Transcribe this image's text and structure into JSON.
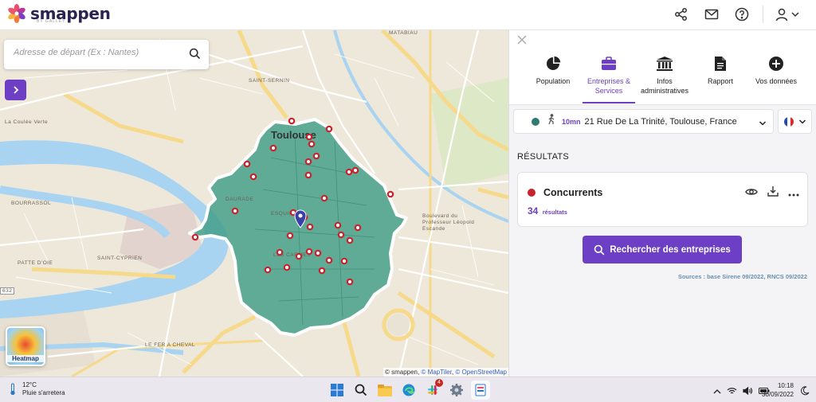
{
  "app": {
    "name": "smappen",
    "logo_sub": "BY GALLEY"
  },
  "header": {
    "icons": [
      "share-icon",
      "mail-icon",
      "help-icon",
      "user-icon",
      "chevron-down-icon"
    ]
  },
  "map": {
    "search_placeholder": "Adresse de départ (Ex : Nantes)",
    "search_value": "",
    "heatmap_label": "Heatmap",
    "attribution_prefix": "© smappen, ",
    "attribution_maptiler": "© MapTiler",
    "attribution_sep": ", ",
    "attribution_osm": "© OpenStreetMap",
    "labels": {
      "city": "Toulouse",
      "matabiau": "MATABIAU",
      "saint_sernin": "SAINT-SERNIN",
      "coulee_verte": "La Coulée Verte",
      "saint_cyprien": "SAINT-CYPRIEN",
      "patte_doie": "PATTE D'OIE",
      "bourrassol": "BOURRASSOL",
      "esquirol": "ESQUIROL",
      "carmes": "LES CARMES",
      "fer_a_cheval": "LE FER A CHEVAL",
      "daurade": "DAURADE",
      "boulevard": "Boulevard du Professeur Léopold Escande",
      "route_632": "632"
    },
    "colors": {
      "zone_fill": "#3f9e86",
      "water": "#a8d3f1",
      "marker": "#c8232c",
      "pin": "#3b3fa8"
    }
  },
  "panel": {
    "tabs": [
      {
        "label": "Population",
        "icon": "pie-chart-icon",
        "active": false
      },
      {
        "label": "Entreprises & Services",
        "icon": "briefcase-icon",
        "active": true
      },
      {
        "label": "Infos administratives",
        "icon": "institution-icon",
        "active": false
      },
      {
        "label": "Rapport",
        "icon": "document-icon",
        "active": false
      },
      {
        "label": "Vos données",
        "icon": "plus-circle-icon",
        "active": false
      }
    ],
    "isochrone": {
      "minutes": "10mn",
      "address": "21 Rue De La Trinité, Toulouse, France"
    },
    "results_title": "RÉSULTATS",
    "card": {
      "title": "Concurrents",
      "count": "34",
      "count_unit": "résultats"
    },
    "search_button": "Rechercher des entreprises",
    "sources": "Sources : base Sirene 09/2022, RNCS 09/2022",
    "accent_color": "#6c3fc4"
  },
  "taskbar": {
    "temperature": "12°C",
    "weather": "Pluie s'arretera",
    "time": "10:18",
    "date": "30/09/2022",
    "apps": [
      "windows-start-icon",
      "search-icon",
      "file-explorer-icon",
      "edge-icon",
      "slack-icon",
      "settings-icon",
      "smappen-app-icon"
    ],
    "slack_badge": "4"
  }
}
